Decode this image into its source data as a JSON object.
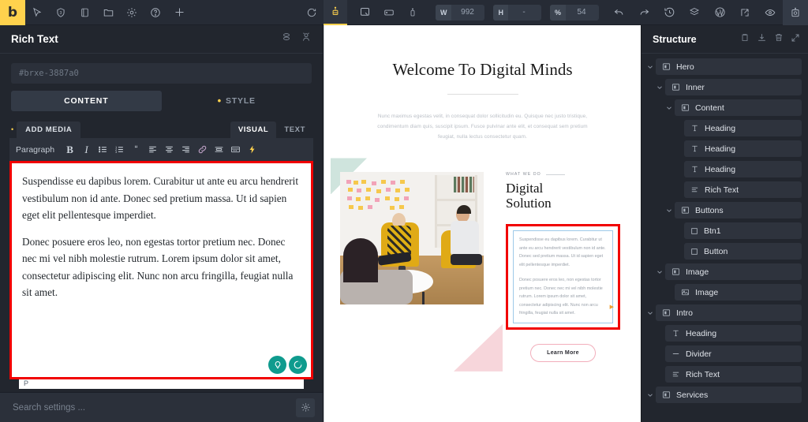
{
  "topbar": {
    "logo": "b",
    "left_icons": [
      {
        "name": "cursor-icon",
        "glyph": "cursor"
      },
      {
        "name": "shield-icon",
        "glyph": "shield"
      },
      {
        "name": "page-icon",
        "glyph": "page"
      },
      {
        "name": "folder-icon",
        "glyph": "folder"
      },
      {
        "name": "gear-icon",
        "glyph": "gear"
      },
      {
        "name": "help-icon",
        "glyph": "help"
      },
      {
        "name": "plus-icon",
        "glyph": "plus"
      }
    ],
    "center_icons": [
      {
        "name": "refresh-icon",
        "glyph": "refresh"
      },
      {
        "name": "responsive-base-icon",
        "glyph": "base"
      },
      {
        "name": "breakpoint-desktop-icon",
        "glyph": "desktop"
      },
      {
        "name": "breakpoint-tablet-icon",
        "glyph": "tablet"
      },
      {
        "name": "breakpoint-mobile-icon",
        "glyph": "mobile"
      }
    ],
    "fields": [
      {
        "key": "W",
        "value": "992"
      },
      {
        "key": "H",
        "value": "-"
      },
      {
        "key": "%",
        "value": "54"
      }
    ],
    "right_icons": [
      {
        "name": "undo-icon",
        "glyph": "undo"
      },
      {
        "name": "redo-icon",
        "glyph": "redo"
      },
      {
        "name": "revisions-icon",
        "glyph": "history"
      },
      {
        "name": "templates-icon",
        "glyph": "layers"
      },
      {
        "name": "wordpress-icon",
        "glyph": "wordpress"
      },
      {
        "name": "open-external-icon",
        "glyph": "external"
      },
      {
        "name": "preview-icon",
        "glyph": "eye"
      },
      {
        "name": "save-icon",
        "glyph": "save"
      }
    ]
  },
  "left_panel": {
    "title": "Rich Text",
    "header_icons": [
      {
        "name": "duplicate-settings-icon"
      },
      {
        "name": "user-settings-icon"
      }
    ],
    "element_id": "#brxe-3887a0",
    "tabs": [
      {
        "label": "CONTENT",
        "active": true,
        "dot": false
      },
      {
        "label": "STYLE",
        "active": false,
        "dot": true
      }
    ],
    "editor": {
      "add_media_label": "ADD MEDIA",
      "mode_tabs": [
        {
          "label": "VISUAL",
          "active": true
        },
        {
          "label": "TEXT",
          "active": false
        }
      ],
      "format_select": "Paragraph",
      "toolbar_buttons": [
        {
          "name": "bold-icon",
          "label": "B"
        },
        {
          "name": "italic-icon",
          "label": "I"
        },
        {
          "name": "bullet-list-icon"
        },
        {
          "name": "numbered-list-icon"
        },
        {
          "name": "blockquote-icon",
          "label": "“"
        },
        {
          "name": "align-left-icon"
        },
        {
          "name": "align-center-icon"
        },
        {
          "name": "align-right-icon"
        },
        {
          "name": "insert-link-icon"
        },
        {
          "name": "read-more-icon"
        },
        {
          "name": "toggle-toolbar-icon"
        },
        {
          "name": "shortcode-icon"
        }
      ],
      "paragraphs": [
        "Suspendisse eu dapibus lorem. Curabitur ut ante eu arcu hendrerit vestibulum non id ante. Donec sed pretium massa. Ut id sapien eget elit pellentesque imperdiet.",
        "Donec posuere eros leo, non egestas tortor pretium nec. Donec nec mi vel nibh molestie rutrum. Lorem ipsum dolor sit amet, consectetur adipiscing elit. Nunc non arcu fringilla, feugiat nulla sit amet."
      ],
      "badges": [
        {
          "name": "grammarly-suggestion-icon"
        },
        {
          "name": "grammarly-status-icon"
        }
      ],
      "status_line": "P"
    },
    "footer": {
      "search_placeholder": "Search settings ...",
      "gear_icon": "gear-icon"
    },
    "selection_outline_color": "#f10000"
  },
  "canvas": {
    "hero_heading": "Welcome To Digital Minds",
    "hero_paragraph": "Nunc maximus egestas velit, in consequat dolor sollicitudin eu. Quisque nec justo tristique, condimentum diam quis, suscipit ipsum. Fusce pulvinar ante elit, et consequat sem pretium feugiat, nulla lectus consectetur quam.",
    "eyebrow": "WHAT WE DO",
    "section_heading_line1": "Digital",
    "section_heading_line2": "Solution",
    "rich_text_paragraphs": [
      "Suspendisse eu dapibus lorem. Curabitur ut ante eu arcu hendrerit vestibulum non id ante. Donec sed pretium massa. Ut id sapien eget elit pellentesque imperdiet.",
      "Donec posuere eros leo, non egestas tortor pretium nec. Donec nec mi vel nibh molestie rutrum. Lorem ipsum dolor sit amet, consectetur adipiscing elit. Nunc non arcu fringilla, feugiat nulla sit amet."
    ],
    "button_label": "Learn More",
    "accent_highlight": "#fbe2a7",
    "accent_heading_highlight": "#fbd98e",
    "button_border": "#f2aebb",
    "selection_outline_color": "#f10000",
    "image_alt": "people-meeting-photo"
  },
  "right_panel": {
    "title": "Structure",
    "header_icons": [
      {
        "name": "clipboard-icon"
      },
      {
        "name": "download-icon"
      },
      {
        "name": "trash-icon"
      },
      {
        "name": "collapse-icon"
      }
    ],
    "tree": [
      {
        "label": "Hero",
        "indent": 0,
        "icon": "container-icon",
        "caret": true
      },
      {
        "label": "Inner",
        "indent": 1,
        "icon": "container-icon",
        "caret": true
      },
      {
        "label": "Content",
        "indent": 2,
        "icon": "container-icon",
        "caret": true
      },
      {
        "label": "Heading",
        "indent": 3,
        "icon": "text-icon",
        "caret": false
      },
      {
        "label": "Heading",
        "indent": 3,
        "icon": "text-icon",
        "caret": false
      },
      {
        "label": "Heading",
        "indent": 3,
        "icon": "text-icon",
        "caret": false
      },
      {
        "label": "Rich Text",
        "indent": 3,
        "icon": "richtext-icon",
        "caret": false
      },
      {
        "label": "Buttons",
        "indent": 2,
        "icon": "container-icon",
        "caret": true
      },
      {
        "label": "Btn1",
        "indent": 3,
        "icon": "button-icon",
        "caret": false
      },
      {
        "label": "Button",
        "indent": 3,
        "icon": "button-icon",
        "caret": false
      },
      {
        "label": "Image",
        "indent": 1,
        "icon": "container-icon",
        "caret": true
      },
      {
        "label": "Image",
        "indent": 2,
        "icon": "image-icon",
        "caret": false
      },
      {
        "label": "Intro",
        "indent": 0,
        "icon": "container-icon",
        "caret": true
      },
      {
        "label": "Heading",
        "indent": 1,
        "icon": "text-icon",
        "caret": false
      },
      {
        "label": "Divider",
        "indent": 1,
        "icon": "divider-icon",
        "caret": false
      },
      {
        "label": "Rich Text",
        "indent": 1,
        "icon": "richtext-icon",
        "caret": false
      },
      {
        "label": "Services",
        "indent": 0,
        "icon": "container-icon",
        "caret": true
      }
    ]
  }
}
